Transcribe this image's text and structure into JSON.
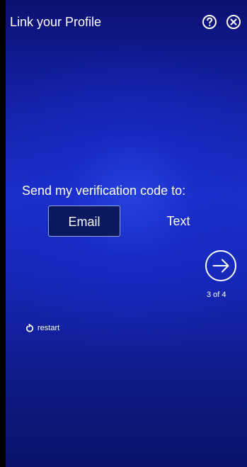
{
  "header": {
    "title": "Link your Profile"
  },
  "verification": {
    "prompt": "Send my verification code to:",
    "options": [
      {
        "label": "Email",
        "selected": true
      },
      {
        "label": "Text",
        "selected": false
      }
    ]
  },
  "navigation": {
    "step_text": "3 of 4",
    "restart_label": "restart"
  },
  "icons": {
    "help": "help-circle-icon",
    "close": "close-circle-icon",
    "next": "arrow-right-circle-icon",
    "restart": "restart-icon"
  },
  "colors": {
    "background_primary": "#1a30c9",
    "background_dark": "#0c1070",
    "selected_option_background": "#0a1860",
    "text": "#ffffff",
    "selected_option_border": "#c3d2ff"
  }
}
